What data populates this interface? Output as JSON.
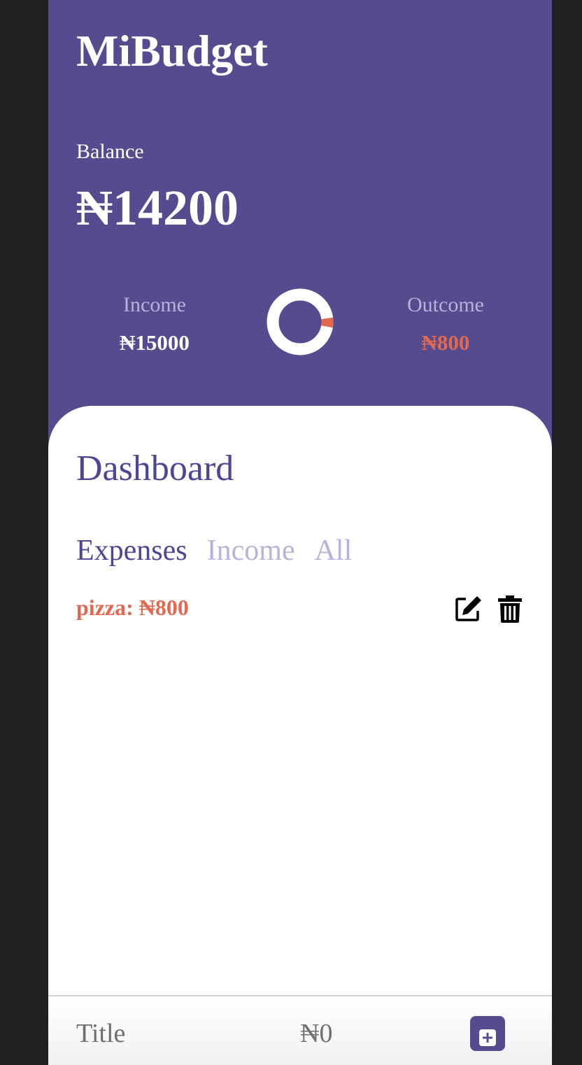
{
  "app": {
    "title": "MiBudget"
  },
  "balance": {
    "label": "Balance",
    "value": "₦14200"
  },
  "summary": {
    "income_label": "Income",
    "income_value": "₦15000",
    "outcome_label": "Outcome",
    "outcome_value": "₦800",
    "income_amount": 15000,
    "outcome_amount": 800
  },
  "colors": {
    "header_bg": "#544c8f",
    "accent": "#4d4596",
    "muted": "#b7b2dc",
    "expense": "#e2684f",
    "surface": "#ffffff"
  },
  "dashboard": {
    "title": "Dashboard",
    "tabs": [
      {
        "label": "Expenses",
        "active": true
      },
      {
        "label": "Income",
        "active": false
      },
      {
        "label": "All",
        "active": false
      }
    ],
    "entries": [
      {
        "title": "pizza:",
        "amount": "₦800",
        "edit_icon": "edit-icon",
        "delete_icon": "trash-icon"
      }
    ]
  },
  "form": {
    "title_placeholder": "Title",
    "amount_placeholder": "₦0",
    "add_icon": "plus-icon"
  }
}
